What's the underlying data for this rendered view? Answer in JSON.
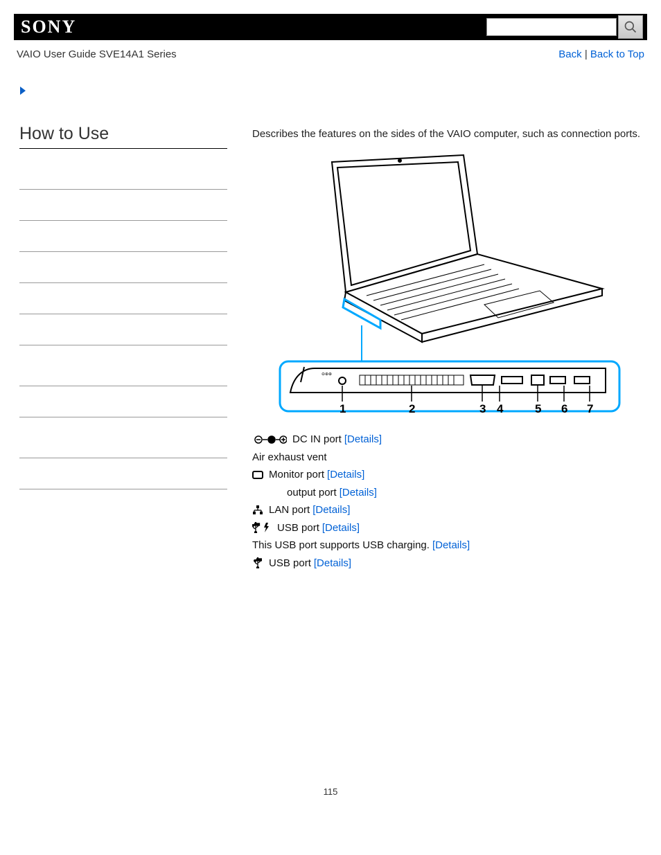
{
  "header": {
    "logo": "SONY",
    "guide_title": "VAIO User Guide SVE14A1 Series",
    "back_link": "Back",
    "back_to_top_link": "Back to Top",
    "link_separator": " | "
  },
  "left": {
    "heading": "How to Use"
  },
  "content": {
    "intro": "Describes the features on the sides of the VAIO computer, such as connection ports.",
    "diagram_callouts": [
      "1",
      "2",
      "3",
      "4",
      "5",
      "6",
      "7"
    ],
    "items": [
      {
        "label": "DC IN port ",
        "link": "[Details]"
      },
      {
        "label": "Air exhaust vent",
        "link": ""
      },
      {
        "label": "Monitor port ",
        "link": "[Details]"
      },
      {
        "label": " output port ",
        "link": "[Details]"
      },
      {
        "label": "LAN port ",
        "link": "[Details]"
      },
      {
        "label": "USB port ",
        "link": "[Details]"
      },
      {
        "label": "This USB port supports USB charging. ",
        "link": "[Details]"
      },
      {
        "label": "USB port ",
        "link": "[Details]"
      }
    ]
  },
  "page_number": "115"
}
